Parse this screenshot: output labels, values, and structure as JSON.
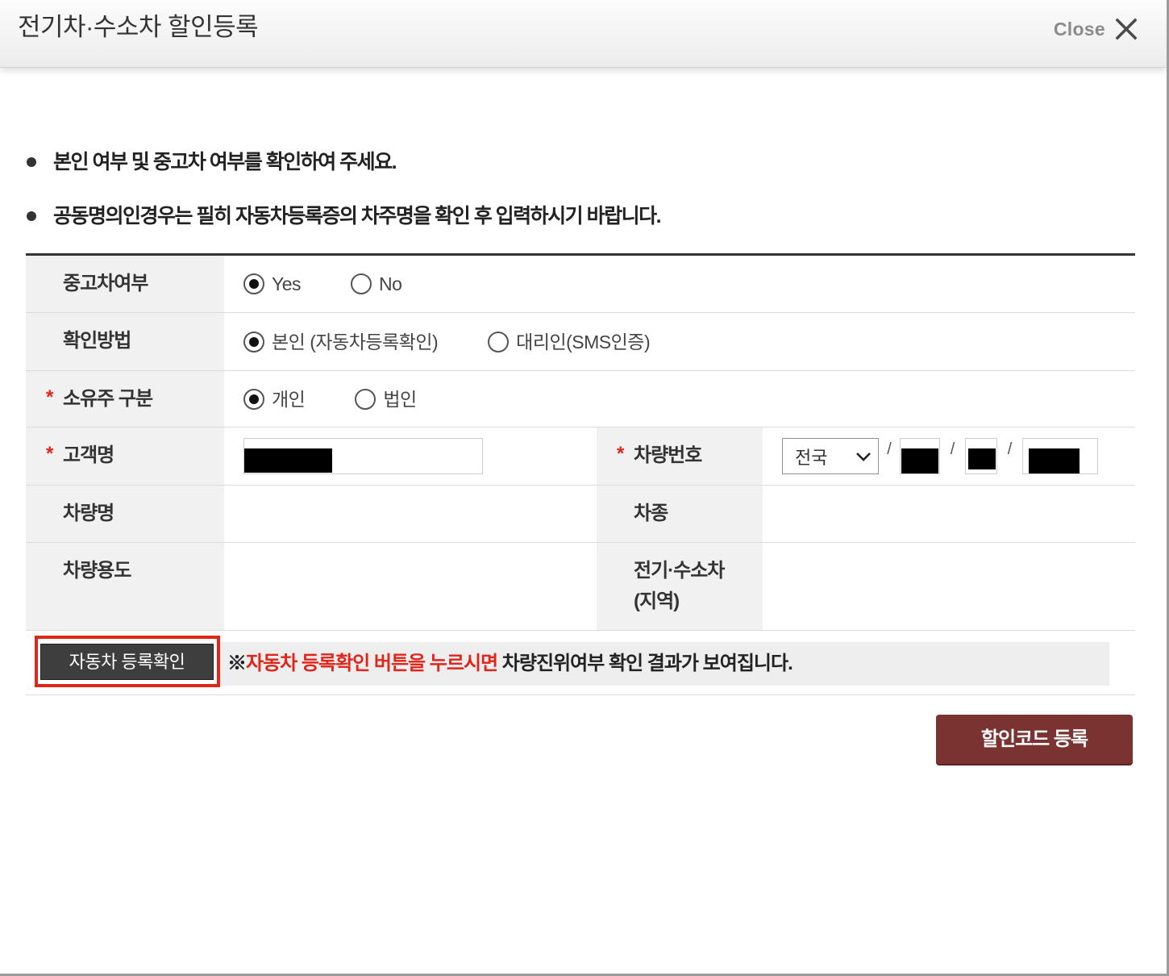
{
  "dialog": {
    "title": "전기차·수소차 할인등록",
    "close_label": "Close"
  },
  "icons": {
    "close": "close-icon",
    "bullet": "bullet-icon",
    "region_dropdown": "chevron-down-icon"
  },
  "notices": [
    "본인 여부 및 중고차 여부를 확인하여 주세요.",
    "공동명의인경우는 필히 자동차등록증의 차주명을 확인 후 입력하시기 바랍니다."
  ],
  "form": {
    "required_mark": "*",
    "used_car": {
      "label": "중고차여부",
      "options": [
        {
          "label": "Yes",
          "checked": true
        },
        {
          "label": "No",
          "checked": false
        }
      ]
    },
    "verify_method": {
      "label": "확인방법",
      "options": [
        {
          "label": "본인 (자동차등록확인)",
          "checked": true
        },
        {
          "label": "대리인(SMS인증)",
          "checked": false
        }
      ]
    },
    "owner_type": {
      "label": "소유주 구분",
      "options": [
        {
          "label": "개인",
          "checked": true
        },
        {
          "label": "법인",
          "checked": false
        }
      ]
    },
    "customer_name": {
      "label": "고객명"
    },
    "plate_number": {
      "label": "차량번호",
      "region": "전국",
      "separator": "/"
    },
    "vehicle_name": {
      "label": "차량명"
    },
    "vehicle_type": {
      "label": "차종"
    },
    "vehicle_usage": {
      "label": "차량용도"
    },
    "ev_region": {
      "label_line1": "전기·수소차",
      "label_line2": "(지역)"
    }
  },
  "verify": {
    "button_label": "자동차 등록확인",
    "note_prefix": "※",
    "note_highlight": "자동차 등록확인 버튼을 누르시면",
    "note_rest": " 차량진위여부 확인 결과가 보여집니다."
  },
  "submit": {
    "label": "할인코드 등록"
  },
  "colors": {
    "accent_red": "#e1251b",
    "submit_bg": "#7a3331",
    "verify_button_bg": "#3e3e3e",
    "label_bg": "#f1f1f1",
    "table_rule": "#333333"
  }
}
